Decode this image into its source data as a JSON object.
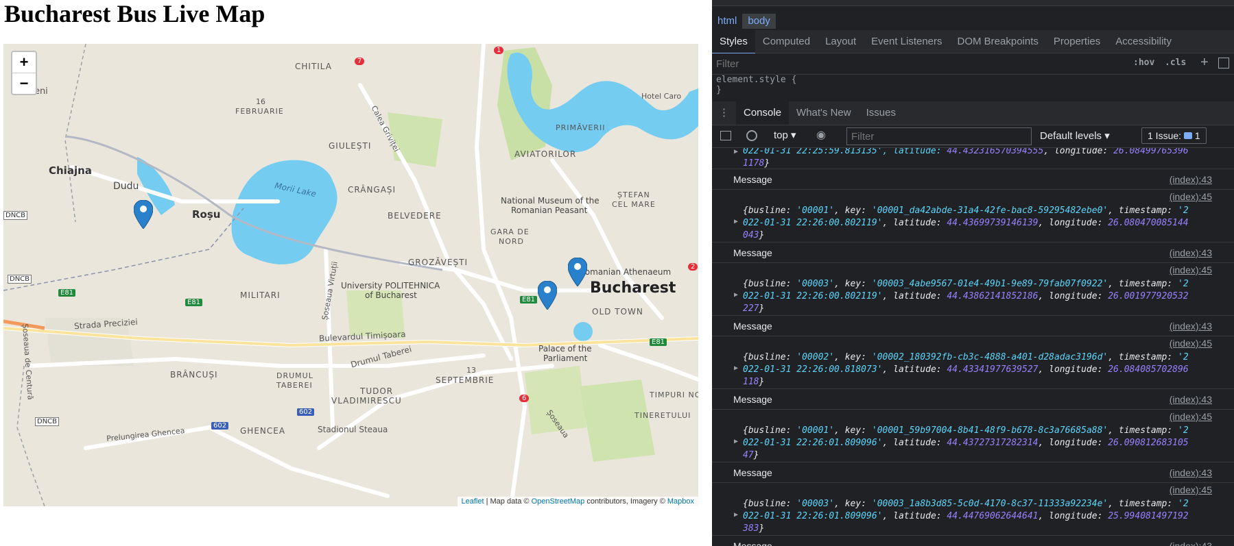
{
  "page": {
    "title": "Bucharest Bus Live Map"
  },
  "map": {
    "zoom_in": "+",
    "zoom_out": "−",
    "labels": {
      "rudeni": "Rudeni",
      "chitila": "CHITILA",
      "feb16": "16",
      "februarie": "FEBRUARIE",
      "calea_grivitei": "Calea Griviței",
      "primaverii": "PRIMĂVERII",
      "hotel": "Hotel Caro",
      "chiajna": "Chiajna",
      "dudu": "Dudu",
      "giulesti": "GIULEȘTI",
      "aviatorilor": "AVIATORILOR",
      "morii": "Morii Lake",
      "crangasi": "CRÂNGAȘI",
      "stefan": "ȘTEFAN",
      "cel_mare": "CEL MARE",
      "rosu": "Roșu",
      "museum1": "National Museum of the",
      "museum2": "Romanian Peasant",
      "belvedere": "BELVEDERE",
      "gara1": "GARA DE",
      "gara2": "NORD",
      "dncb1": "DNCB",
      "dncb2": "DNCB",
      "dncb3": "DNCB",
      "grozavesti": "GROZĂVEȘTI",
      "athenaeum": "Romanian Athenaeum",
      "univ1": "University POLITEHNICA",
      "univ2": "of Bucharest",
      "bucharest": "Bucharest",
      "militari": "MILITARI",
      "old_town": "OLD TOWN",
      "preciziei": "Strada Preciziei",
      "soseaua_virtutii": "Șoseaua Virtuții",
      "timisoara": "Bulevardul Timișoara",
      "taberei": "Drumul Taberei",
      "palace1": "Palace of the",
      "palace2": "Parliament",
      "brancusi": "BRÂNCUȘI",
      "drumul1": "DRUMUL",
      "drumul2": "TABEREI",
      "s13": "13",
      "septembrie": "SEPTEMBRIE",
      "tudor": "TUDOR",
      "vladimirescu": "VLADIMIRESCU",
      "timpuri": "TIMPURI NO",
      "tineretului": "TINERETULUI",
      "centura": "Șoseaua de Centură",
      "ghencea": "GHENCEA",
      "stadion": "Stadionul Steaua",
      "ghencea_st": "Prelungirea Ghencea",
      "soseaua2": "Șoseaua",
      "e81a": "E81",
      "e81b": "E81",
      "e81c": "E81",
      "e81d": "E81",
      "r7": "7",
      "r1": "1",
      "r2": "2",
      "r6": "6",
      "r602a": "602",
      "r602b": "602"
    },
    "attribution": {
      "leaflet": "Leaflet",
      "sep1": " | Map data © ",
      "osm": "OpenStreetMap",
      "sep2": " contributors, Imagery © ",
      "mapbox": "Mapbox"
    }
  },
  "devtools": {
    "breadcrumb": [
      "html",
      "body"
    ],
    "panel_tabs": [
      "Styles",
      "Computed",
      "Layout",
      "Event Listeners",
      "DOM Breakpoints",
      "Properties",
      "Accessibility"
    ],
    "styles_filter_placeholder": "Filter",
    "hov": ":hov",
    "cls": ".cls",
    "plus": "+",
    "element_style_open": "element.style {",
    "element_style_close": "}",
    "drawer_tabs": [
      "Console",
      "What's New",
      "Issues"
    ],
    "context": "top",
    "console_filter_placeholder": "Filter",
    "levels": "Default levels",
    "issues_label": "1 Issue:",
    "issues_count": "1",
    "log": {
      "first_partial": {
        "line1_pre": "022-01-31 22:25:59.813135', latitude: ",
        "lat": "44.432316570394555",
        "mid": ", longitude: ",
        "lon1": "26.08499765396",
        "lon2": "1178",
        "close": "}"
      },
      "message_text": "Message",
      "message_src": "(index):43",
      "object_src": "(index):45",
      "entries": [
        {
          "busline": "'00001'",
          "key": "'00001_da42abde-31a4-42fe-bac8-59295482ebe0'",
          "ts1": "'2",
          "ts2": "022-01-31 22:26:00.802119'",
          "lat": "44.43699739146139",
          "lon1": "26.080470085144",
          "lon2": "043"
        },
        {
          "busline": "'00003'",
          "key": "'00003_4abe9567-01e4-49b1-9e89-79fab07f0922'",
          "ts1": "'2",
          "ts2": "022-01-31 22:26:00.802119'",
          "lat": "44.43862141852186",
          "lon1": "26.001977920532",
          "lon2": "227"
        },
        {
          "busline": "'00002'",
          "key": "'00002_180392fb-cb3c-4888-a401-d28adac3196d'",
          "ts1": "'2",
          "ts2": "022-01-31 22:26:00.818073'",
          "lat": "44.43341977639527",
          "lon1": "26.084085702896",
          "lon2": "118"
        },
        {
          "busline": "'00001'",
          "key": "'00001_59b97004-8b41-48f9-b678-8c3a76685a88'",
          "ts1": "'2",
          "ts2": "022-01-31 22:26:01.809096'",
          "lat": "44.43727317282314",
          "lon1": "26.090812683105",
          "lon2": "47"
        },
        {
          "busline": "'00003'",
          "key": "'00003_1a8b3d85-5c0d-4170-8c37-11333a92234e'",
          "ts1": "'2",
          "ts2": "022-01-31 22:26:01.809096'",
          "lat": "44.44769062644641",
          "lon1": "25.994081497192",
          "lon2": "383"
        }
      ]
    }
  }
}
